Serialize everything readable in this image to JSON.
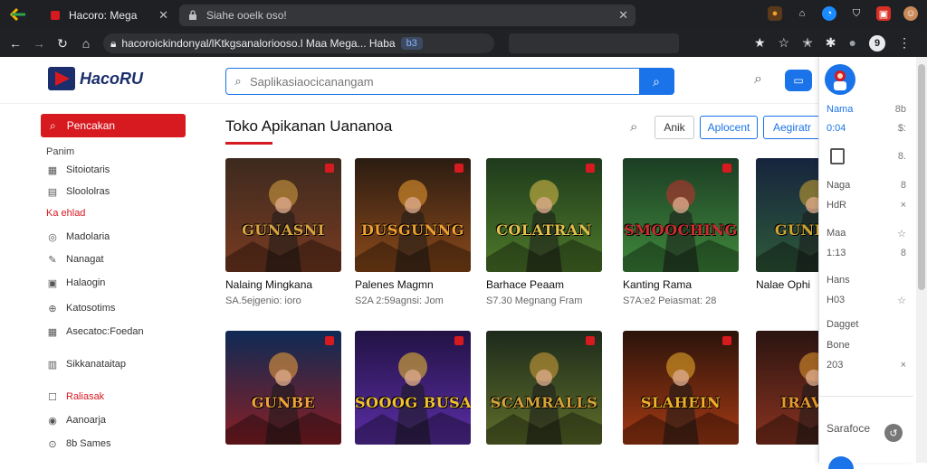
{
  "browser": {
    "tabs": [
      {
        "title": "Hacoro: Mega",
        "active": true
      },
      {
        "title": "Siahe ooelk oso!",
        "active": false
      }
    ],
    "omnibox_url": "hacoroickindonyal/lKtkgsanaloriooso.l Maa Mega... Haba",
    "omnibox_chip": "b3",
    "profile_initial": "9"
  },
  "app": {
    "logo_text": "HacoRU",
    "search_placeholder": "Saplikasiaocicanangam",
    "header_blue_icon": "card-icon"
  },
  "sidebar": {
    "primary_button": "Pencakan",
    "heading": "Panim",
    "items": [
      {
        "label": "Sitoiotaris",
        "icon": "grid-icon",
        "style": "normal"
      },
      {
        "label": "Sloololras",
        "icon": "doc-icon",
        "style": "normal"
      },
      {
        "label": "Ka ehlad",
        "icon": "",
        "style": "red"
      },
      {
        "label": "Madolaria",
        "icon": "globe-icon",
        "style": "normal"
      },
      {
        "label": "Nanagat",
        "icon": "edit-icon",
        "style": "normal"
      },
      {
        "label": "Halaogin",
        "icon": "calendar-icon",
        "style": "normal"
      },
      {
        "label": "Katosotims",
        "icon": "gamepad-icon",
        "style": "normal"
      },
      {
        "label": "Asecatoc:Foedan",
        "icon": "table-icon",
        "style": "normal"
      },
      {
        "label": "Sikkanataitap",
        "icon": "store-icon",
        "style": "normal"
      },
      {
        "label": "Raliasak",
        "icon": "square-icon",
        "style": "red"
      },
      {
        "label": "Aanoarja",
        "icon": "circle-icon",
        "style": "normal"
      },
      {
        "label": "8b Sames",
        "icon": "badge-icon",
        "style": "normal"
      }
    ]
  },
  "main": {
    "title": "Toko Apikanan   Uananoa",
    "buttons": [
      "Anik",
      "Aplocent",
      "Aegiratr"
    ],
    "cards": [
      {
        "title": "Nalaing Mingkana",
        "sub": "SA.5ejgenio: ioro",
        "art": "GUNASNI",
        "palette": [
          "#3c2a1e",
          "#7a3b22",
          "#d9a441"
        ]
      },
      {
        "title": "Palenes Magmn",
        "sub": "S2A 2:59agnsi: Jom",
        "art": "DUSGUNNG",
        "palette": [
          "#2b1c12",
          "#8c4a1a",
          "#f0a030"
        ]
      },
      {
        "title": "Barhace Peaam",
        "sub": "S7.30 Megnang Fram",
        "art": "COLATRAN",
        "palette": [
          "#1e3a1c",
          "#4f7a2a",
          "#e2c14a"
        ]
      },
      {
        "title": "Kanting Rama",
        "sub": "S7A:e2 Peiasmat: 28",
        "art": "SMOOCHING",
        "palette": [
          "#1c3d24",
          "#3f8a3c",
          "#c92f2f"
        ]
      },
      {
        "title": "Nalae Ophi",
        "sub": "",
        "art": "GUNDAN",
        "palette": [
          "#16243d",
          "#2e5a3a",
          "#d0a630"
        ]
      },
      {
        "title": "",
        "sub": "",
        "art": "GUNBE",
        "palette": [
          "#0e2a55",
          "#8a1f24",
          "#f2a43a"
        ]
      },
      {
        "title": "",
        "sub": "",
        "art": "SOOOG BUSANA",
        "palette": [
          "#221244",
          "#5b2ea6",
          "#f2c230"
        ]
      },
      {
        "title": "",
        "sub": "",
        "art": "SCAMRALLS",
        "palette": [
          "#1d2a1c",
          "#5f6f2a",
          "#d8a43a"
        ]
      },
      {
        "title": "",
        "sub": "",
        "art": "SLAHEIN",
        "palette": [
          "#2a130a",
          "#a63a14",
          "#f0b02a"
        ]
      },
      {
        "title": "",
        "sub": "",
        "art": "IRAVED",
        "palette": [
          "#2a1410",
          "#8a3320",
          "#e89a30"
        ]
      }
    ]
  },
  "right_panel": {
    "rows": [
      {
        "label": "Nama",
        "value": "8b",
        "blue": true
      },
      {
        "label": "0:04",
        "value": "$:",
        "blue": true
      },
      {
        "label": "",
        "value": "8.",
        "blue": false
      },
      {
        "label": "Naga",
        "value": "8",
        "blue": false
      },
      {
        "label": "HdR",
        "value": "×",
        "blue": false
      },
      {
        "label": "Maa",
        "value": "☆",
        "blue": false
      },
      {
        "label": "1:13",
        "value": "8",
        "blue": false
      },
      {
        "label": "Hans",
        "value": "",
        "blue": false
      },
      {
        "label": "H03",
        "value": "☆",
        "blue": false
      },
      {
        "label": "Dagget",
        "value": "",
        "blue": false
      },
      {
        "label": "Bone",
        "value": "",
        "blue": false
      },
      {
        "label": "203",
        "value": "×",
        "blue": false
      }
    ],
    "bottom_label": "Sarafoce"
  }
}
